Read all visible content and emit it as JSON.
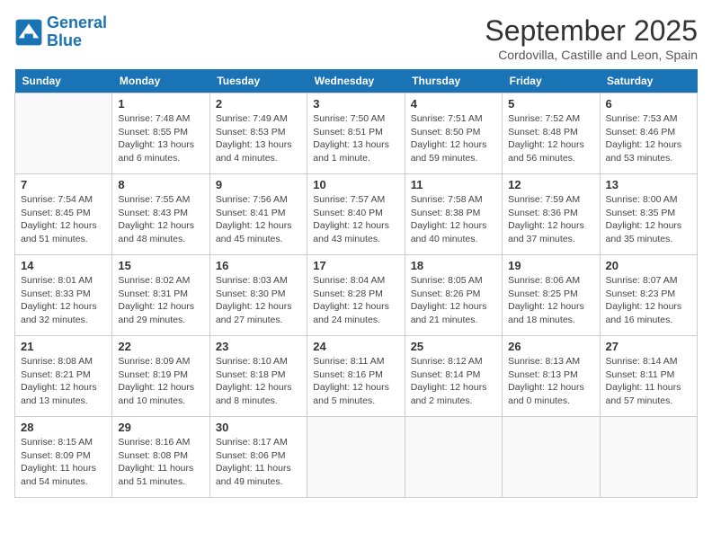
{
  "header": {
    "logo_line1": "General",
    "logo_line2": "Blue",
    "month": "September 2025",
    "location": "Cordovilla, Castille and Leon, Spain"
  },
  "weekdays": [
    "Sunday",
    "Monday",
    "Tuesday",
    "Wednesday",
    "Thursday",
    "Friday",
    "Saturday"
  ],
  "weeks": [
    [
      {
        "day": "",
        "info": ""
      },
      {
        "day": "1",
        "info": "Sunrise: 7:48 AM\nSunset: 8:55 PM\nDaylight: 13 hours\nand 6 minutes."
      },
      {
        "day": "2",
        "info": "Sunrise: 7:49 AM\nSunset: 8:53 PM\nDaylight: 13 hours\nand 4 minutes."
      },
      {
        "day": "3",
        "info": "Sunrise: 7:50 AM\nSunset: 8:51 PM\nDaylight: 13 hours\nand 1 minute."
      },
      {
        "day": "4",
        "info": "Sunrise: 7:51 AM\nSunset: 8:50 PM\nDaylight: 12 hours\nand 59 minutes."
      },
      {
        "day": "5",
        "info": "Sunrise: 7:52 AM\nSunset: 8:48 PM\nDaylight: 12 hours\nand 56 minutes."
      },
      {
        "day": "6",
        "info": "Sunrise: 7:53 AM\nSunset: 8:46 PM\nDaylight: 12 hours\nand 53 minutes."
      }
    ],
    [
      {
        "day": "7",
        "info": "Sunrise: 7:54 AM\nSunset: 8:45 PM\nDaylight: 12 hours\nand 51 minutes."
      },
      {
        "day": "8",
        "info": "Sunrise: 7:55 AM\nSunset: 8:43 PM\nDaylight: 12 hours\nand 48 minutes."
      },
      {
        "day": "9",
        "info": "Sunrise: 7:56 AM\nSunset: 8:41 PM\nDaylight: 12 hours\nand 45 minutes."
      },
      {
        "day": "10",
        "info": "Sunrise: 7:57 AM\nSunset: 8:40 PM\nDaylight: 12 hours\nand 43 minutes."
      },
      {
        "day": "11",
        "info": "Sunrise: 7:58 AM\nSunset: 8:38 PM\nDaylight: 12 hours\nand 40 minutes."
      },
      {
        "day": "12",
        "info": "Sunrise: 7:59 AM\nSunset: 8:36 PM\nDaylight: 12 hours\nand 37 minutes."
      },
      {
        "day": "13",
        "info": "Sunrise: 8:00 AM\nSunset: 8:35 PM\nDaylight: 12 hours\nand 35 minutes."
      }
    ],
    [
      {
        "day": "14",
        "info": "Sunrise: 8:01 AM\nSunset: 8:33 PM\nDaylight: 12 hours\nand 32 minutes."
      },
      {
        "day": "15",
        "info": "Sunrise: 8:02 AM\nSunset: 8:31 PM\nDaylight: 12 hours\nand 29 minutes."
      },
      {
        "day": "16",
        "info": "Sunrise: 8:03 AM\nSunset: 8:30 PM\nDaylight: 12 hours\nand 27 minutes."
      },
      {
        "day": "17",
        "info": "Sunrise: 8:04 AM\nSunset: 8:28 PM\nDaylight: 12 hours\nand 24 minutes."
      },
      {
        "day": "18",
        "info": "Sunrise: 8:05 AM\nSunset: 8:26 PM\nDaylight: 12 hours\nand 21 minutes."
      },
      {
        "day": "19",
        "info": "Sunrise: 8:06 AM\nSunset: 8:25 PM\nDaylight: 12 hours\nand 18 minutes."
      },
      {
        "day": "20",
        "info": "Sunrise: 8:07 AM\nSunset: 8:23 PM\nDaylight: 12 hours\nand 16 minutes."
      }
    ],
    [
      {
        "day": "21",
        "info": "Sunrise: 8:08 AM\nSunset: 8:21 PM\nDaylight: 12 hours\nand 13 minutes."
      },
      {
        "day": "22",
        "info": "Sunrise: 8:09 AM\nSunset: 8:19 PM\nDaylight: 12 hours\nand 10 minutes."
      },
      {
        "day": "23",
        "info": "Sunrise: 8:10 AM\nSunset: 8:18 PM\nDaylight: 12 hours\nand 8 minutes."
      },
      {
        "day": "24",
        "info": "Sunrise: 8:11 AM\nSunset: 8:16 PM\nDaylight: 12 hours\nand 5 minutes."
      },
      {
        "day": "25",
        "info": "Sunrise: 8:12 AM\nSunset: 8:14 PM\nDaylight: 12 hours\nand 2 minutes."
      },
      {
        "day": "26",
        "info": "Sunrise: 8:13 AM\nSunset: 8:13 PM\nDaylight: 12 hours\nand 0 minutes."
      },
      {
        "day": "27",
        "info": "Sunrise: 8:14 AM\nSunset: 8:11 PM\nDaylight: 11 hours\nand 57 minutes."
      }
    ],
    [
      {
        "day": "28",
        "info": "Sunrise: 8:15 AM\nSunset: 8:09 PM\nDaylight: 11 hours\nand 54 minutes."
      },
      {
        "day": "29",
        "info": "Sunrise: 8:16 AM\nSunset: 8:08 PM\nDaylight: 11 hours\nand 51 minutes."
      },
      {
        "day": "30",
        "info": "Sunrise: 8:17 AM\nSunset: 8:06 PM\nDaylight: 11 hours\nand 49 minutes."
      },
      {
        "day": "",
        "info": ""
      },
      {
        "day": "",
        "info": ""
      },
      {
        "day": "",
        "info": ""
      },
      {
        "day": "",
        "info": ""
      }
    ]
  ]
}
